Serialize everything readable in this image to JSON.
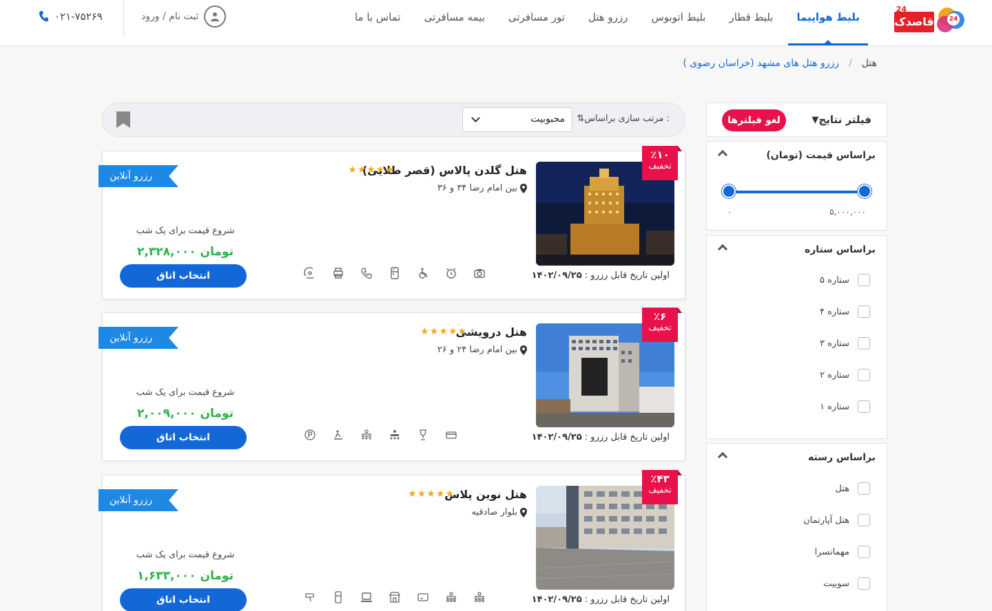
{
  "header": {
    "logo_text": "قاصدک",
    "logo_badge": "24",
    "nav": [
      {
        "label": "بلیط هواپیما",
        "active": true
      },
      {
        "label": "بلیط قطار",
        "active": false
      },
      {
        "label": "بلیط اتوبوس",
        "active": false
      },
      {
        "label": "رزرو هتل",
        "active": false
      },
      {
        "label": "تور مسافرتی",
        "active": false
      },
      {
        "label": "بیمه مسافرتی",
        "active": false
      },
      {
        "label": "تماس با ما",
        "active": false
      }
    ],
    "login_label": "ثبت نام / ورود",
    "phone": "۰۲۱-۷۵۲۶۹"
  },
  "breadcrumb": {
    "home": "هتل",
    "separator": "/",
    "current": "رزرو هتل های مشهد (خراسان رضوی )"
  },
  "filters": {
    "title": "فیلتر نتایج",
    "clear_label": "لغو فیلترها",
    "price": {
      "title": "براساس قیمت (تومان)",
      "min": "۰",
      "max": "۵,۰۰۰,۰۰۰"
    },
    "stars": {
      "title": "براساس ستاره",
      "options": [
        "۵ ستاره",
        "۴ ستاره",
        "۳ ستاره",
        "۲ ستاره",
        "۱ ستاره"
      ]
    },
    "category": {
      "title": "براساس رسته",
      "options": [
        "هتل",
        "هتل آپارتمان",
        "مهمانسرا",
        "سوییت"
      ]
    }
  },
  "sort": {
    "label": "مرتب سازی براساس :",
    "value": "محبوبیت"
  },
  "hotels": [
    {
      "name": "هتل گلدن پالاس (قصر طلایی)",
      "stars": "★★★★★",
      "address": "بین امام رضا ۳۴ و ۳۶",
      "discount_pct": "٪۱۰",
      "discount_label": "تخفیف",
      "first_date_label": "اولین تاریخ قابل رزرو :",
      "first_date": "۱۴۰۲/۰۹/۲۵",
      "online_label": "رزرو آنلاین",
      "price_caption": "شروع قیمت برای یک شب",
      "price": "۲,۳۲۸,۰۰۰ تومان",
      "button": "انتخاب اتاق",
      "amenities": [
        "satellite-icon",
        "printer-icon",
        "phone-icon",
        "fridge-icon",
        "wheelchair-icon",
        "alarm-icon",
        "camera-icon"
      ]
    },
    {
      "name": "هتل درویشی",
      "stars": "★★★★★",
      "address": "بین امام رضا ۲۴ و ۲۶",
      "discount_pct": "٪۶",
      "discount_label": "تخفیف",
      "first_date_label": "اولین تاریخ قابل رزرو :",
      "first_date": "۱۴۰۲/۰۹/۲۵",
      "online_label": "رزرو آنلاین",
      "price_caption": "شروع قیمت برای یک شب",
      "price": "۲,۰۰۹,۰۰۰ تومان",
      "button": "انتخاب اتاق",
      "amenities": [
        "parking-icon",
        "spa-icon",
        "conference-icon",
        "meeting-icon",
        "trophy-icon",
        "card-icon"
      ]
    },
    {
      "name": "هتل نوین پلاس",
      "stars": "★★★★★",
      "address": "بلوار صادقیه",
      "discount_pct": "٪۴۳",
      "discount_label": "تخفیف",
      "first_date_label": "اولین تاریخ قابل رزرو :",
      "first_date": "۱۴۰۲/۰۹/۲۵",
      "online_label": "رزرو آنلاین",
      "price_caption": "شروع قیمت برای یک شب",
      "price": "۱,۶۳۳,۰۰۰ تومان",
      "button": "انتخاب اتاق",
      "amenities": [
        "hairdryer-icon",
        "fridge-icon",
        "laptop-icon",
        "shop-icon",
        "card-icon",
        "conference-icon",
        "meeting-icon"
      ]
    }
  ],
  "colors": {
    "brand_blue": "#1268d6",
    "accent_red": "#e8114a",
    "price_green": "#2bb24c",
    "ribbon_blue": "#1e88e5",
    "star_gold": "#f2a81d"
  }
}
